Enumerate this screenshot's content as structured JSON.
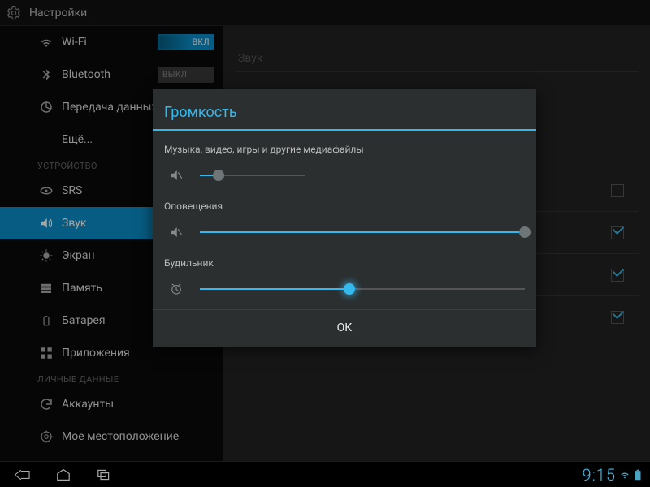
{
  "actionbar": {
    "title": "Настройки"
  },
  "sidebar": {
    "items": [
      {
        "label": "Wi-Fi",
        "toggle": "ВКЛ"
      },
      {
        "label": "Bluetooth",
        "toggle": "ВЫКЛ"
      },
      {
        "label": "Передача данных"
      },
      {
        "label": "Ещё..."
      }
    ],
    "cat_device": "УСТРОЙСТВО",
    "device": [
      {
        "label": "SRS"
      },
      {
        "label": "Звук"
      },
      {
        "label": "Экран"
      },
      {
        "label": "Память"
      },
      {
        "label": "Батарея"
      },
      {
        "label": "Приложения"
      }
    ],
    "cat_personal": "ЛИЧНЫЕ ДАННЫЕ",
    "personal": [
      {
        "label": "Аккаунты"
      },
      {
        "label": "Мое местоположение"
      }
    ]
  },
  "content": {
    "section_title": "Звук",
    "rows": [
      {
        "checked": false
      },
      {
        "checked": true
      },
      {
        "checked": true
      },
      {
        "checked": true
      }
    ]
  },
  "dialog": {
    "title": "Громкость",
    "media_label": "Музыка, видео, игры и другие медиафайлы",
    "media_pct": 18,
    "notif_label": "Оповещения",
    "notif_pct": 100,
    "alarm_label": "Будильник",
    "alarm_pct": 46,
    "ok": "ОК"
  },
  "navbar": {
    "clock": "9:15"
  },
  "colors": {
    "accent": "#35b8ec",
    "toggle_on": "#0c8ec9"
  }
}
